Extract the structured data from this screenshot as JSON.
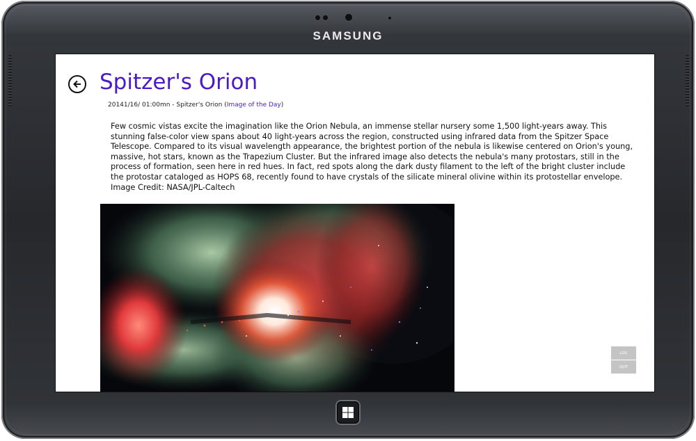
{
  "device": {
    "brand": "SAMSUNG"
  },
  "page": {
    "title": "Spitzer's Orion",
    "meta": {
      "date": "20141/16/ 01:00mn",
      "separator": "-",
      "name": "Spitzer's Orion",
      "open_paren": "(",
      "link_label": "Image of the Day",
      "close_paren": ")"
    },
    "description": "Few cosmic vistas excite the imagination like the Orion Nebula, an immense stellar nursery some 1,500 light-years away. This stunning false-color view spans about 40 light-years across the region, constructed using infrared data from the Spitzer Space Telescope. Compared to its visual wavelength appearance, the brightest portion of the nebula is likewise centered on Orion's young, massive, hot stars, known as the Trapezium Cluster. But the infrared image also detects the nebula's many protostars, still in the process of formation, seen here in red hues. In fact, red spots along the dark dusty filament to the left of the bright cluster include the protostar cataloged as HOPS 68, recently found to have crystals of the silicate mineral olivine within its protostellar envelope.",
    "credit": "Image Credit: NASA/JPL-Caltech"
  },
  "buttons": {
    "log": "LOG",
    "quit": "QUIT"
  },
  "icons": {
    "back": "back-arrow-icon",
    "home": "windows-logo-icon"
  },
  "colors": {
    "title": "#4a19c9",
    "link": "#4a19c9",
    "side_button": "#c4c4c4"
  }
}
